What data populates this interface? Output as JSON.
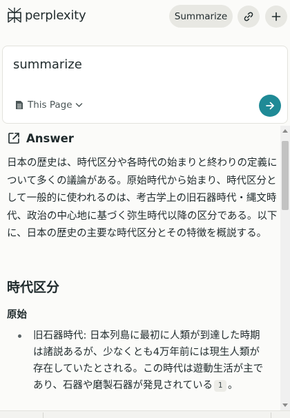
{
  "header": {
    "logo_text": "perplexity",
    "summarize_button": "Summarize",
    "link_icon": "link-icon",
    "plus_icon": "plus-icon"
  },
  "query": {
    "text": "summarize",
    "source_label": "This Page",
    "source_icon": "document-icon",
    "submit_icon": "arrow-right-icon"
  },
  "answer": {
    "heading": "Answer",
    "heading_icon": "external-link-icon",
    "paragraph": "日本の歴史は、時代区分や各時代の始まりと終わりの定義について多くの議論がある。原始時代から始まり、時代区分として一般的に使われるのは、考古学上の旧石器時代・縄文時代、政治の中心地に基づく弥生時代以降の区分である。以下に、日本の歴史の主要な時代区分とその特徴を概説する。",
    "section_heading": "時代区分",
    "sub_heading": "原始",
    "bullets": [
      {
        "text": "旧石器時代: 日本列島に最初に人類が到達した時期は諸説あるが、少なくとも4万年前には現生人類が存在していたとされる。この時代は遊動生活が主であり、石器や磨製石器が発見されている",
        "citation": "1",
        "trailing": "。"
      }
    ]
  },
  "colors": {
    "accent": "#1f8a96",
    "pill_bg": "#e8e8e3",
    "page_bg": "#fbfbf9",
    "text": "#1f2a2c"
  }
}
